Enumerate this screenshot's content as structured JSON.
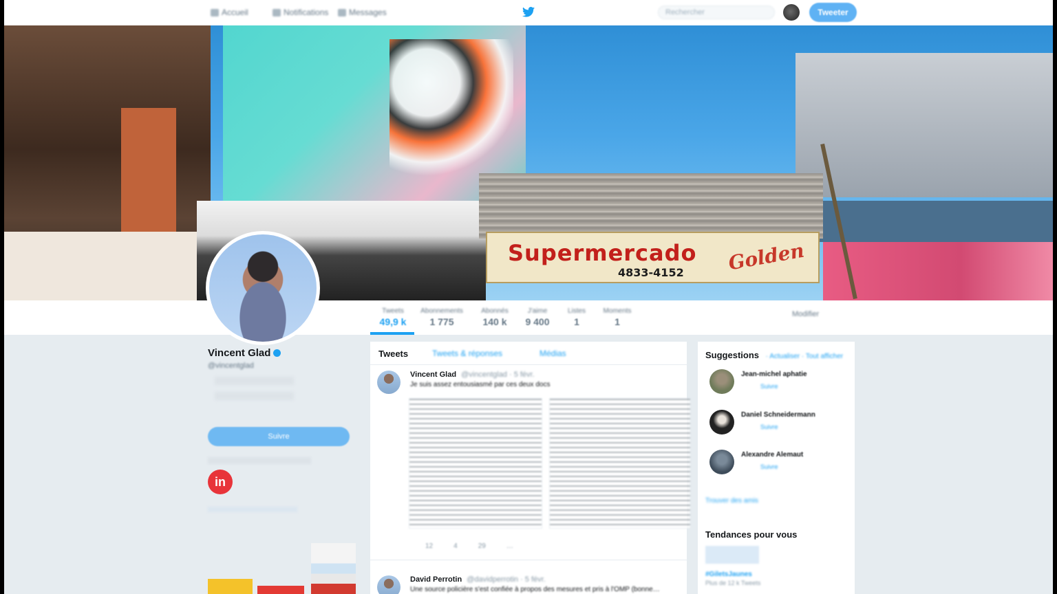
{
  "nav": {
    "items": [
      {
        "label": "Accueil",
        "icon": "home-icon"
      },
      {
        "label": "Notifications",
        "icon": "bell-icon"
      },
      {
        "label": "Messages",
        "icon": "envelope-icon"
      }
    ],
    "search_placeholder": "Rechercher",
    "tweet_button": "Tweeter",
    "brand_icon": "twitter-bird-icon"
  },
  "banner": {
    "sign_text": "Supermercado",
    "sign_phone": "4833-4152",
    "sign_script": "Golden"
  },
  "profile": {
    "name": "Vincent Glad",
    "handle": "@vincentglad",
    "follow_button": "Suivre",
    "edit_button": "Modifier",
    "logo_text": "in"
  },
  "stats": [
    {
      "label": "Tweets",
      "value": "49,9 k"
    },
    {
      "label": "Abonnements",
      "value": "1 775"
    },
    {
      "label": "Abonnés",
      "value": "140 k"
    },
    {
      "label": "J'aime",
      "value": "9 400"
    },
    {
      "label": "Listes",
      "value": "1"
    },
    {
      "label": "Moments",
      "value": "1"
    }
  ],
  "timeline": {
    "tabs": [
      "Tweets",
      "Tweets & réponses",
      "Médias"
    ],
    "tweets": [
      {
        "author": "Vincent Glad",
        "meta": "@vincentglad · 5 févr.",
        "text": "Je suis assez entousiasmé par ces deux docs"
      },
      {
        "author": "David Perrotin",
        "meta": "@davidperrotin · 5 févr.",
        "text": "Une source policière s'est confiée à propos des mesures et pris à l'OMP (bonne…"
      }
    ],
    "actions": [
      "12",
      "4",
      "29",
      "…"
    ]
  },
  "sidebar": {
    "suggestions_title": "Suggestions",
    "suggestions_sub": "· Actualiser · Tout afficher",
    "suggestions": [
      {
        "name": "Jean-michel aphatie",
        "button": "Suivre"
      },
      {
        "name": "Daniel Schneidermann",
        "button": "Suivre"
      },
      {
        "name": "Alexandre Alemaut",
        "button": "Suivre"
      }
    ],
    "find_link": "Trouver des amis",
    "trends_title": "Tendances pour vous",
    "trend_name": "#GiletsJaunes",
    "trend_meta": "Plus de 12 k Tweets"
  },
  "colors": {
    "accent": "#1da1f2",
    "background": "#e6ecf0"
  }
}
